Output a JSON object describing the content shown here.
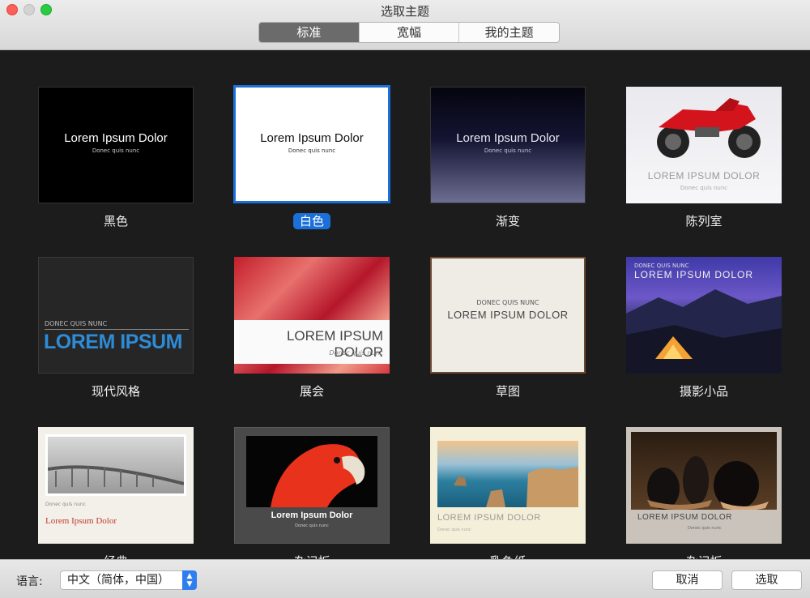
{
  "window": {
    "title": "选取主题"
  },
  "tabs": [
    {
      "label": "标准",
      "active": true
    },
    {
      "label": "宽幅",
      "active": false
    },
    {
      "label": "我的主题",
      "active": false
    }
  ],
  "themes": [
    {
      "name": "黑色",
      "title": "Lorem Ipsum Dolor",
      "subtitle": "Donec quis nunc",
      "selected": false
    },
    {
      "name": "白色",
      "title": "Lorem Ipsum Dolor",
      "subtitle": "Donec quis nunc",
      "selected": true
    },
    {
      "name": "渐变",
      "title": "Lorem Ipsum Dolor",
      "subtitle": "Donec quis nunc",
      "selected": false
    },
    {
      "name": "陈列室",
      "title": "LOREM IPSUM DOLOR",
      "subtitle": "Donec quis nunc",
      "selected": false
    },
    {
      "name": "现代风格",
      "title": "LOREM IPSUM",
      "subtitle": "DONEC QUIS NUNC",
      "selected": false
    },
    {
      "name": "展会",
      "title": "LOREM IPSUM DOLOR",
      "subtitle": "Donec quis nunc",
      "selected": false
    },
    {
      "name": "草图",
      "title": "LOREM IPSUM DOLOR",
      "subtitle": "DONEC QUIS NUNC",
      "selected": false
    },
    {
      "name": "摄影小品",
      "title": "LOREM IPSUM DOLOR",
      "subtitle": "DONEC QUIS NUNC",
      "selected": false
    },
    {
      "name": "经典",
      "title": "Lorem Ipsum Dolor",
      "subtitle": "Donec quis nunc",
      "selected": false
    },
    {
      "name": "杂记板",
      "title": "Lorem Ipsum Dolor",
      "subtitle": "Donec quis nunc",
      "selected": false
    },
    {
      "name": "乳色纸",
      "title": "LOREM IPSUM DOLOR",
      "subtitle": "Donec quis nunc",
      "selected": false
    },
    {
      "name": "杂记板",
      "title": "LOREM IPSUM DOLOR",
      "subtitle": "Donec quis nunc",
      "selected": false
    }
  ],
  "footer": {
    "language_label": "语言:",
    "language_value": "中文（简体，中国）",
    "cancel_label": "取消",
    "choose_label": "选取"
  },
  "colors": {
    "accent": "#1a6fd8",
    "modern_blue": "#2e8bd6"
  }
}
